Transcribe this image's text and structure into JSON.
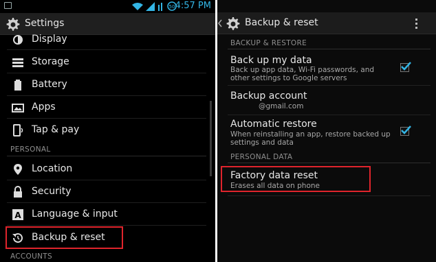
{
  "status_bar": {
    "time": "4:57 PM"
  },
  "left_screen": {
    "title": "Settings",
    "items_top": [
      {
        "label": "Display",
        "icon": "display-icon"
      },
      {
        "label": "Storage",
        "icon": "storage-icon"
      },
      {
        "label": "Battery",
        "icon": "battery-icon"
      },
      {
        "label": "Apps",
        "icon": "apps-icon"
      },
      {
        "label": "Tap & pay",
        "icon": "tap-pay-icon"
      }
    ],
    "section_personal": "PERSONAL",
    "items_personal": [
      {
        "label": "Location",
        "icon": "location-icon"
      },
      {
        "label": "Security",
        "icon": "security-icon"
      },
      {
        "label": "Language & input",
        "icon": "language-icon"
      },
      {
        "label": "Backup & reset",
        "icon": "backup-reset-icon"
      }
    ],
    "section_accounts": "ACCOUNTS"
  },
  "right_screen": {
    "title": "Backup & reset",
    "section_backup": "BACKUP & RESTORE",
    "backup_data": {
      "title": "Back up my data",
      "subtitle": "Back up app data, Wi-Fi passwords, and other settings to Google servers",
      "checked": true
    },
    "backup_account": {
      "title": "Backup account",
      "subtitle": "@gmail.com"
    },
    "auto_restore": {
      "title": "Automatic restore",
      "subtitle": "When reinstalling an app, restore backed up settings and data",
      "checked": true
    },
    "section_personal_data": "PERSONAL DATA",
    "factory_reset": {
      "title": "Factory data reset",
      "subtitle": "Erases all data on phone"
    }
  },
  "colors": {
    "accent_blue": "#33b5e5",
    "highlight_red": "#e0242c",
    "background": "#000000"
  }
}
